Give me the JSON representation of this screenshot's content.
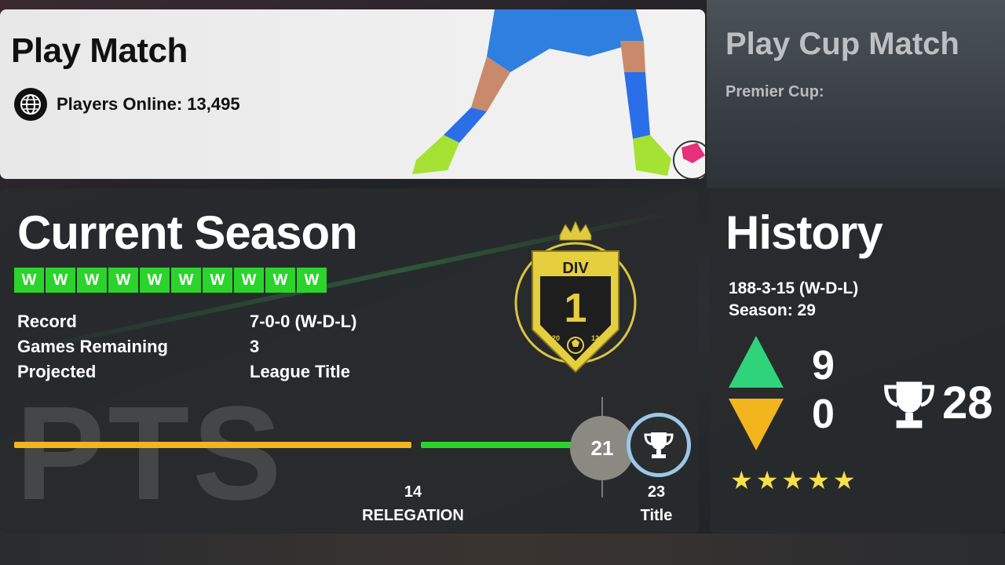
{
  "play_match": {
    "title": "Play Match",
    "online_label": "Players Online: 13,495"
  },
  "cup_match": {
    "title": "Play Cup Match",
    "subtitle": "Premier Cup:"
  },
  "season": {
    "title": "Current Season",
    "form": [
      "W",
      "W",
      "W",
      "W",
      "W",
      "W",
      "W",
      "W",
      "W",
      "W"
    ],
    "stats": [
      {
        "label": "Record",
        "value": "7-0-0 (W-D-L)"
      },
      {
        "label": "Games Remaining",
        "value": "3"
      },
      {
        "label": "Projected",
        "value": "League Title"
      }
    ],
    "badge": {
      "div_label": "DIV",
      "div_number": "1",
      "year_left": "20",
      "year_right": "12"
    },
    "pts_watermark": "PTS",
    "current_points": "21",
    "relegation": {
      "points": "14",
      "label": "RELEGATION"
    },
    "title_target": {
      "points": "23",
      "label": "Title"
    }
  },
  "history": {
    "title": "History",
    "record": "188-3-15 (W-D-L)",
    "season": "Season: 29",
    "promotions": "9",
    "relegations": "0",
    "titles": "28",
    "stars": 5
  },
  "colors": {
    "win_green": "#2bd42b",
    "relegation_orange": "#f2b51e",
    "promo_green": "#2ed37a",
    "relegate_yellow": "#f2b51e",
    "badge_gold": "#d9c640"
  },
  "icons": [
    "globe-icon",
    "trophy-icon",
    "crown-icon",
    "football-icon",
    "up-arrow-icon",
    "down-arrow-icon",
    "star-icon"
  ]
}
